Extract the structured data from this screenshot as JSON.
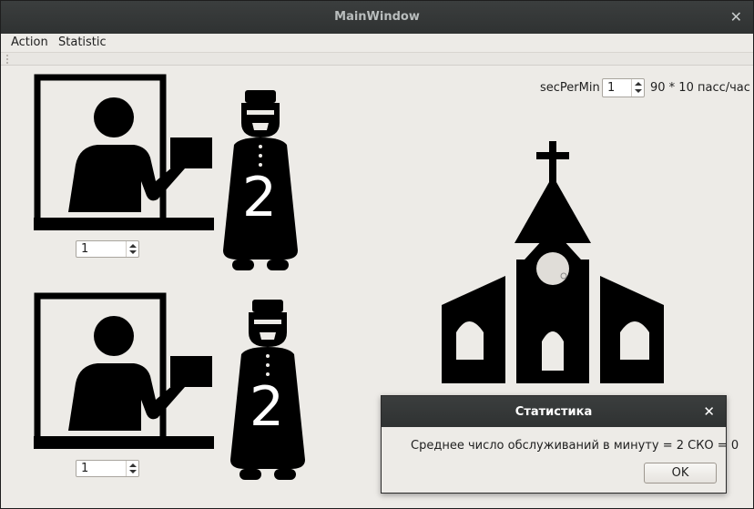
{
  "window": {
    "title": "MainWindow",
    "close_glyph": "✕"
  },
  "menu": {
    "items": [
      {
        "label": "Action"
      },
      {
        "label": "Statistic"
      }
    ]
  },
  "controls": {
    "sec_per_min_label": "secPerMin",
    "sec_per_min_value": "1",
    "rate_text": "90 * 10 пасс/час"
  },
  "stations": [
    {
      "queue_count": "2",
      "spin_value": "1"
    },
    {
      "queue_count": "2",
      "spin_value": "1"
    }
  ],
  "icons": {
    "cashier": "cashier-window-icon",
    "priest": "priest-icon",
    "church": "church-icon"
  },
  "dialog": {
    "title": "Статистика",
    "close_glyph": "✕",
    "message": "Среднее число обслуживаний в минуту = 2 СКО =  0",
    "ok_label": "OK"
  }
}
